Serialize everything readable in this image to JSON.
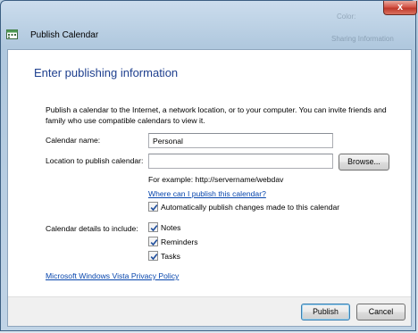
{
  "window": {
    "title": "Publish Calendar",
    "close_glyph": "x",
    "background_ghost": [
      "Color:",
      "Sharing Information"
    ]
  },
  "dialog": {
    "heading": "Enter publishing information",
    "intro": "Publish a calendar to the Internet, a network location, or to your computer. You can invite friends and family who use compatible calendars to view it.",
    "calendar_name_label": "Calendar name:",
    "calendar_name_value": "Personal",
    "location_label": "Location to publish calendar:",
    "location_value": "",
    "browse_label": "Browse...",
    "example_text": "For example: http://servername/webdav",
    "where_link": "Where can I publish this calendar?",
    "auto_publish_label": "Automatically publish changes made to this calendar",
    "auto_publish_checked": true,
    "details_label": "Calendar details to include:",
    "details": [
      {
        "label": "Notes",
        "checked": true
      },
      {
        "label": "Reminders",
        "checked": true
      },
      {
        "label": "Tasks",
        "checked": true
      }
    ],
    "privacy_link": "Microsoft Windows Vista Privacy Policy"
  },
  "footer": {
    "publish_label": "Publish",
    "cancel_label": "Cancel"
  },
  "colors": {
    "heading": "#1e3f8e",
    "link": "#0645ad",
    "checkmark": "#1f4e9c"
  },
  "icons": {
    "app_icon": "calendar-icon",
    "check": "checkmark-icon"
  }
}
